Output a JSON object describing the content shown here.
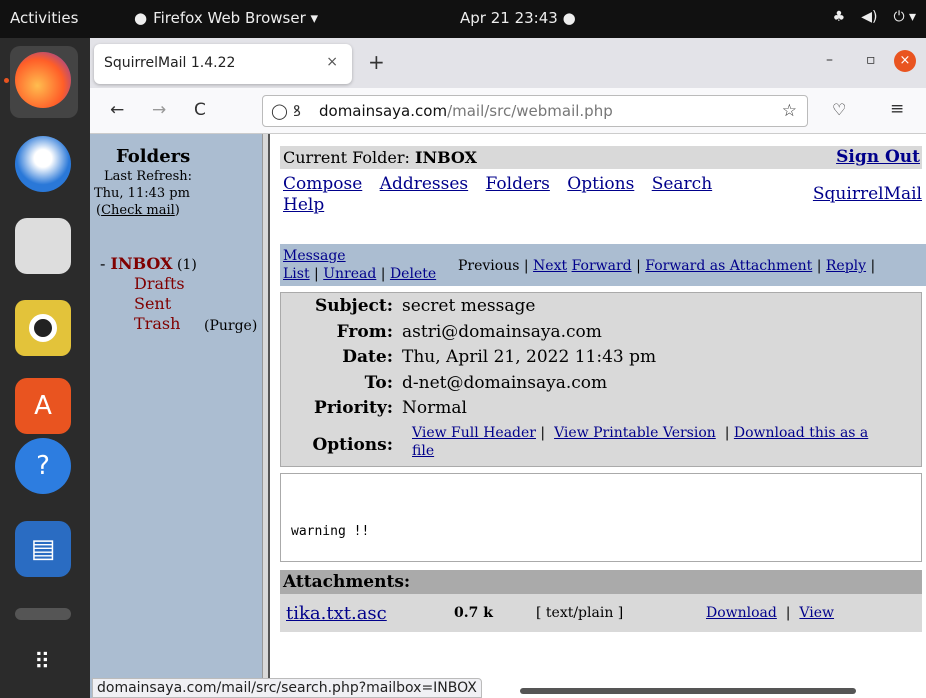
{
  "topbar": {
    "activities": "Activities",
    "app_name": "Firefox Web Browser ▾",
    "clock": "Apr 21  23:43  ●",
    "tray": [
      "♣",
      "◀)",
      "⏻ ▾"
    ]
  },
  "dock": {
    "items": [
      "firefox",
      "thunderbird",
      "files",
      "rhythmbox",
      "software",
      "help",
      "libreoffice-writer",
      "trash",
      "show-apps"
    ]
  },
  "browser": {
    "tab_title": "SquirrelMail 1.4.22",
    "tab_close": "×",
    "new_tab": "+",
    "minimize": "–",
    "maximize": "▫",
    "close": "×",
    "back": "←",
    "forward": "→",
    "reload": "C",
    "url_domain": "domainsaya.com",
    "url_path": "/mail/src/webmail.php",
    "status_url": "domainsaya.com/mail/src/search.php?mailbox=INBOX"
  },
  "left": {
    "title": "Folders",
    "last_refresh": "Last Refresh:",
    "refresh_time": "Thu, 11:43 pm",
    "check_mail_open": "(",
    "check_mail": "Check mail",
    "check_mail_close": ")",
    "inbox_dash": "- ",
    "inbox": "INBOX",
    "inbox_count": " (1)",
    "folders": [
      "Drafts",
      "Sent",
      "Trash"
    ],
    "purge": "(Purge)"
  },
  "main": {
    "current_folder_label": "Current Folder: ",
    "current_folder": "INBOX",
    "sign_out": "Sign Out",
    "links": [
      "Compose",
      "Addresses",
      "Folders",
      "Options",
      "Search"
    ],
    "help": "Help",
    "squirrelmail": "SquirrelMail",
    "message_list_1": "Message",
    "message_list_2": "List",
    "unread": "Unread",
    "delete": "Delete",
    "previous": "Previous",
    "next": "Next",
    "forward": "Forward",
    "forward_attach": "Forward as Attachment",
    "reply": "Reply",
    "subject_label": "Subject:",
    "subject": "secret message",
    "from_label": "From:",
    "from": "astri@domainsaya.com",
    "date_label": "Date:",
    "date": "Thu, April 21, 2022 11:43 pm",
    "to_label": "To:",
    "to": "d-net@domainsaya.com",
    "priority_label": "Priority:",
    "priority": "Normal",
    "options_label": "Options:",
    "view_full_header": "View Full Header",
    "view_printable": "View Printable Version",
    "download_this": "Download this as a",
    "download_file": "file",
    "body_text": "warning !!",
    "attachments_label": "Attachments:",
    "attachment_name": "tika.txt.asc",
    "attachment_size": "0.7 k",
    "attachment_type": "[ text/plain ]",
    "download": "Download",
    "view": "View"
  }
}
